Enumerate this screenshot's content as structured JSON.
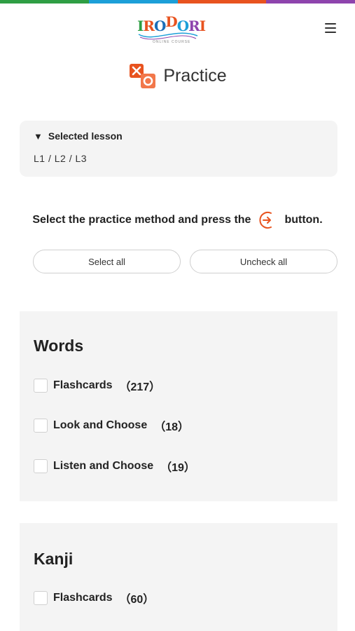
{
  "topbar_colors": [
    "#2f9e44",
    "#1c9fd8",
    "#e8531f",
    "#8e44ad"
  ],
  "header": {
    "logo_text": "IRODORI",
    "logo_subtext": "ONLINE COURSE",
    "logo_letter_colors": [
      "#2f9e44",
      "#e8531f",
      "#1c6fb8",
      "#e8531f",
      "#1c9fd8",
      "#8e44ad",
      "#e8531f"
    ],
    "menu_icon": "hamburger-menu-icon"
  },
  "page": {
    "title": "Practice",
    "title_icon": "practice-icon",
    "accent_color": "#e8531f"
  },
  "lesson": {
    "summary_label": "Selected lesson",
    "marker": "▼",
    "lessons": "L1 / L2 / L3"
  },
  "instruction": {
    "before": "Select the practice method and press the",
    "icon": "arrow-right-circle-icon",
    "after": "button."
  },
  "buttons": {
    "select_all": "Select all",
    "uncheck_all": "Uncheck all"
  },
  "sections": [
    {
      "title": "Words",
      "options": [
        {
          "label": "Flashcards",
          "count": "（217）",
          "checked": false
        },
        {
          "label": "Look and Choose",
          "count": "（18）",
          "checked": false
        },
        {
          "label": "Listen and Choose",
          "count": "（19）",
          "checked": false
        }
      ]
    },
    {
      "title": "Kanji",
      "options": [
        {
          "label": "Flashcards",
          "count": "（60）",
          "checked": false
        }
      ]
    }
  ]
}
